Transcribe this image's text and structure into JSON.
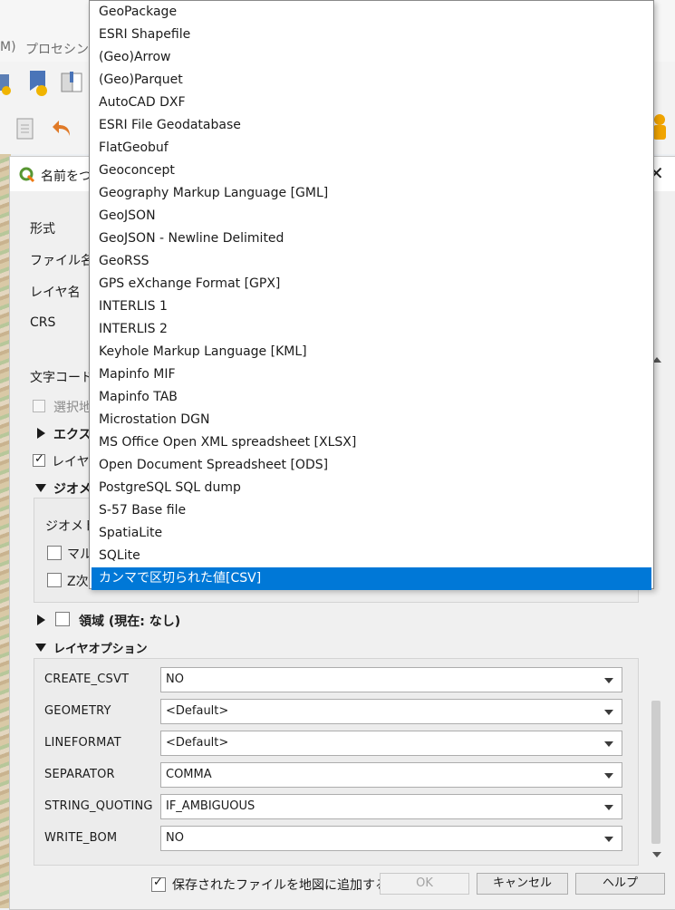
{
  "background": {
    "menu_partial_1": "M)",
    "menu_partial_2": "プロセシング"
  },
  "dialog": {
    "title": "名前をつ",
    "close_icon": "close-icon",
    "fields": {
      "format_label": "形式",
      "filename_label": "ファイル名",
      "layername_label": "レイヤ名",
      "crs_label": "CRS",
      "encoding_label": "文字コード",
      "selected_only_label": "選択地"
    },
    "sections": {
      "export_label": "エクス",
      "layer_cb_label": "レイヤ",
      "geometry_label": "ジオメ",
      "geometry_type_label": "ジオメトリ",
      "multi_label": "マル",
      "z_label": "Z次",
      "extent_label": "領域 (現在: なし)",
      "layer_options_label": "レイヤオプション"
    },
    "layer_options": [
      {
        "name": "CREATE_CSVT",
        "value": "NO"
      },
      {
        "name": "GEOMETRY",
        "value": "<Default>"
      },
      {
        "name": "LINEFORMAT",
        "value": "<Default>"
      },
      {
        "name": "SEPARATOR",
        "value": "COMMA"
      },
      {
        "name": "STRING_QUOTING",
        "value": "IF_AMBIGUOUS"
      },
      {
        "name": "WRITE_BOM",
        "value": "NO"
      }
    ],
    "add_to_map_label": "保存されたファイルを地図に追加する",
    "buttons": {
      "ok": "OK",
      "cancel": "キャンセル",
      "help": "ヘルプ"
    }
  },
  "format_dropdown": {
    "items": [
      "GeoPackage",
      "ESRI Shapefile",
      "(Geo)Arrow",
      "(Geo)Parquet",
      "AutoCAD DXF",
      "ESRI File Geodatabase",
      "FlatGeobuf",
      "Geoconcept",
      "Geography Markup Language [GML]",
      "GeoJSON",
      "GeoJSON - Newline Delimited",
      "GeoRSS",
      "GPS eXchange Format [GPX]",
      "INTERLIS 1",
      "INTERLIS 2",
      "Keyhole Markup Language [KML]",
      "Mapinfo MIF",
      "Mapinfo TAB",
      "Microstation DGN",
      "MS Office Open XML spreadsheet [XLSX]",
      "Open Document Spreadsheet [ODS]",
      "PostgreSQL SQL dump",
      "S-57 Base file",
      "SpatiaLite",
      "SQLite",
      "カンマで区切られた値[CSV]"
    ],
    "selected_index": 25
  },
  "colors": {
    "selection": "#0078d7",
    "dialog_bg": "#f0f0f0"
  }
}
